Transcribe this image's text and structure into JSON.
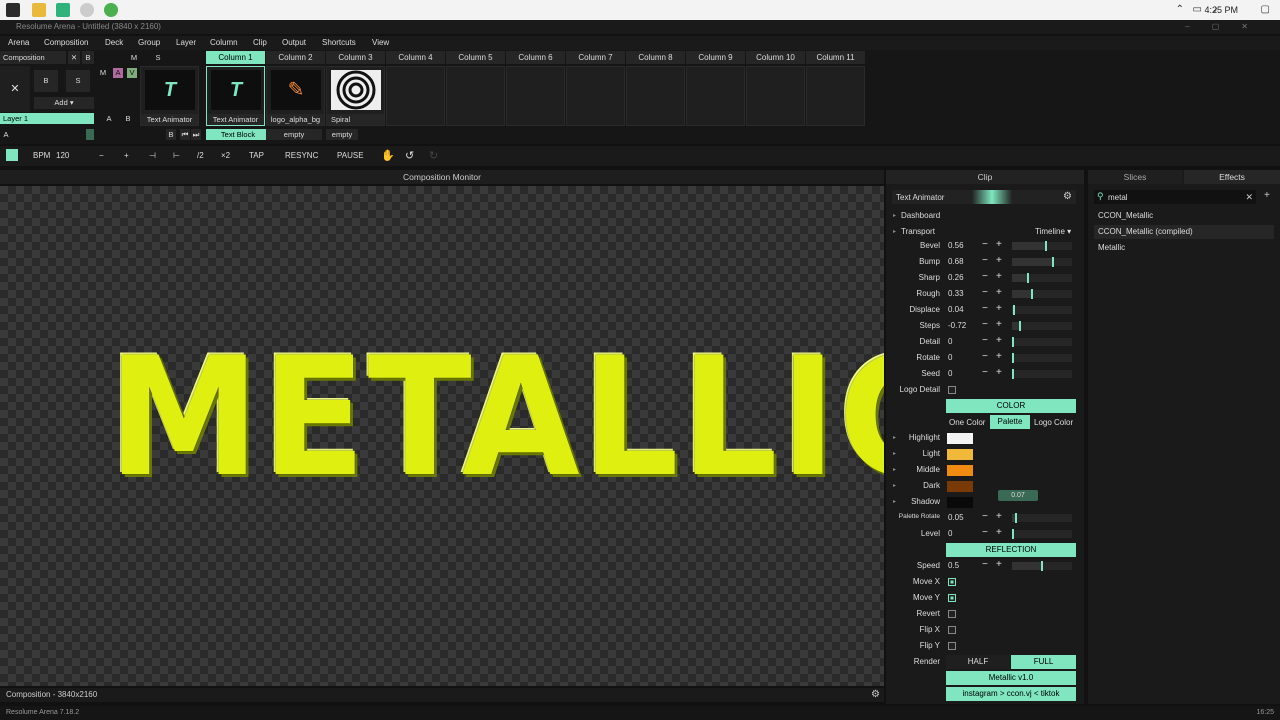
{
  "taskbar": {
    "clock": "4:25 PM",
    "apps": [
      "start-icon",
      "folder-icon",
      "resolume-icon",
      "clock-app-icon",
      "chrome-icon"
    ]
  },
  "window": {
    "title": "Resolume Arena - Untitled (3840 x 2160)"
  },
  "menu": [
    "Arena",
    "Composition",
    "Deck",
    "Group",
    "Layer",
    "Column",
    "Clip",
    "Output",
    "Shortcuts",
    "View"
  ],
  "composition": {
    "label": "Composition",
    "b": "B",
    "m": "M",
    "s": "S",
    "add": "Add",
    "layer_name": "Layer 1",
    "a": "A",
    "bb": "B",
    "layer_a": "A",
    "layer_b": "B"
  },
  "columns": [
    "Column 1",
    "Column 2",
    "Column 3",
    "Column 4",
    "Column 5",
    "Column 6",
    "Column 7",
    "Column 8",
    "Column 9",
    "Column 10",
    "Column 11"
  ],
  "clips": [
    "Text Animator",
    "Text Animator",
    "logo_alpha_bg",
    "Spiral"
  ],
  "layer_clips": [
    "Text Block",
    "empty",
    "empty"
  ],
  "transport": {
    "bpm_label": "BPM",
    "bpm": "120",
    "minus": "−",
    "plus": "+",
    "half": "/2",
    "double": "×2",
    "tap": "TAP",
    "resync": "RESYNC",
    "pause": "PAUSE"
  },
  "monitor": {
    "title": "Composition Monitor",
    "text": "METALLIC",
    "status": "Composition - 3840x2160"
  },
  "footer": {
    "version": "Resolume Arena 7.18.2",
    "time": "16:25"
  },
  "clip_panel": {
    "title": "Clip",
    "clip_name": "Text Animator",
    "dashboard": "Dashboard",
    "transport": "Transport",
    "timeline": "Timeline",
    "params": [
      {
        "label": "Bevel",
        "value": "0.56",
        "fill": 0.56
      },
      {
        "label": "Bump",
        "value": "0.68",
        "fill": 0.68
      },
      {
        "label": "Sharp",
        "value": "0.26",
        "fill": 0.26
      },
      {
        "label": "Rough",
        "value": "0.33",
        "fill": 0.33
      },
      {
        "label": "Displace",
        "value": "0.04",
        "fill": 0.04
      },
      {
        "label": "Steps",
        "value": "-0.72",
        "fill": 0.14
      },
      {
        "label": "Detail",
        "value": "0",
        "fill": 0
      },
      {
        "label": "Rotate",
        "value": "0",
        "fill": 0
      },
      {
        "label": "Seed",
        "value": "0",
        "fill": 0
      }
    ],
    "logo_detail": "Logo Detail",
    "color_section": "COLOR",
    "color_modes": [
      "One Color",
      "Palette",
      "Logo Color"
    ],
    "colors": [
      {
        "label": "Highlight",
        "hex": "#f4f4f4"
      },
      {
        "label": "Light",
        "hex": "#f2b83a"
      },
      {
        "label": "Middle",
        "hex": "#f08a10"
      },
      {
        "label": "Dark",
        "hex": "#7a3a08"
      },
      {
        "label": "Shadow",
        "hex": "#0a0a0a"
      }
    ],
    "tooltip": "0.07",
    "palette_rotate": {
      "label": "Palette Rotate",
      "value": "0.05",
      "fill": 0.05
    },
    "level": {
      "label": "Level",
      "value": "0",
      "fill": 0
    },
    "reflection_section": "REFLECTION",
    "speed": {
      "label": "Speed",
      "value": "0.5",
      "fill": 0.5
    },
    "toggles": [
      {
        "label": "Move X",
        "on": true
      },
      {
        "label": "Move Y",
        "on": true
      },
      {
        "label": "Revert",
        "on": false
      },
      {
        "label": "Flip X",
        "on": false
      },
      {
        "label": "Flip Y",
        "on": false
      }
    ],
    "render_label": "Render",
    "render_half": "HALF",
    "render_full": "FULL",
    "version_btn": "Metallic v1.0",
    "credit_btn": "instagram > ccon.vj < tiktok"
  },
  "effects_panel": {
    "tab_slices": "Slices",
    "tab_effects": "Effects",
    "search_value": "metal",
    "results": [
      "CCON_Metallic",
      "CCON_Metallic (compiled)",
      "Metallic"
    ]
  },
  "colors": {
    "accent": "#7fe6c0",
    "panel": "#1a1a1a",
    "text_fill": "#dfef10"
  }
}
